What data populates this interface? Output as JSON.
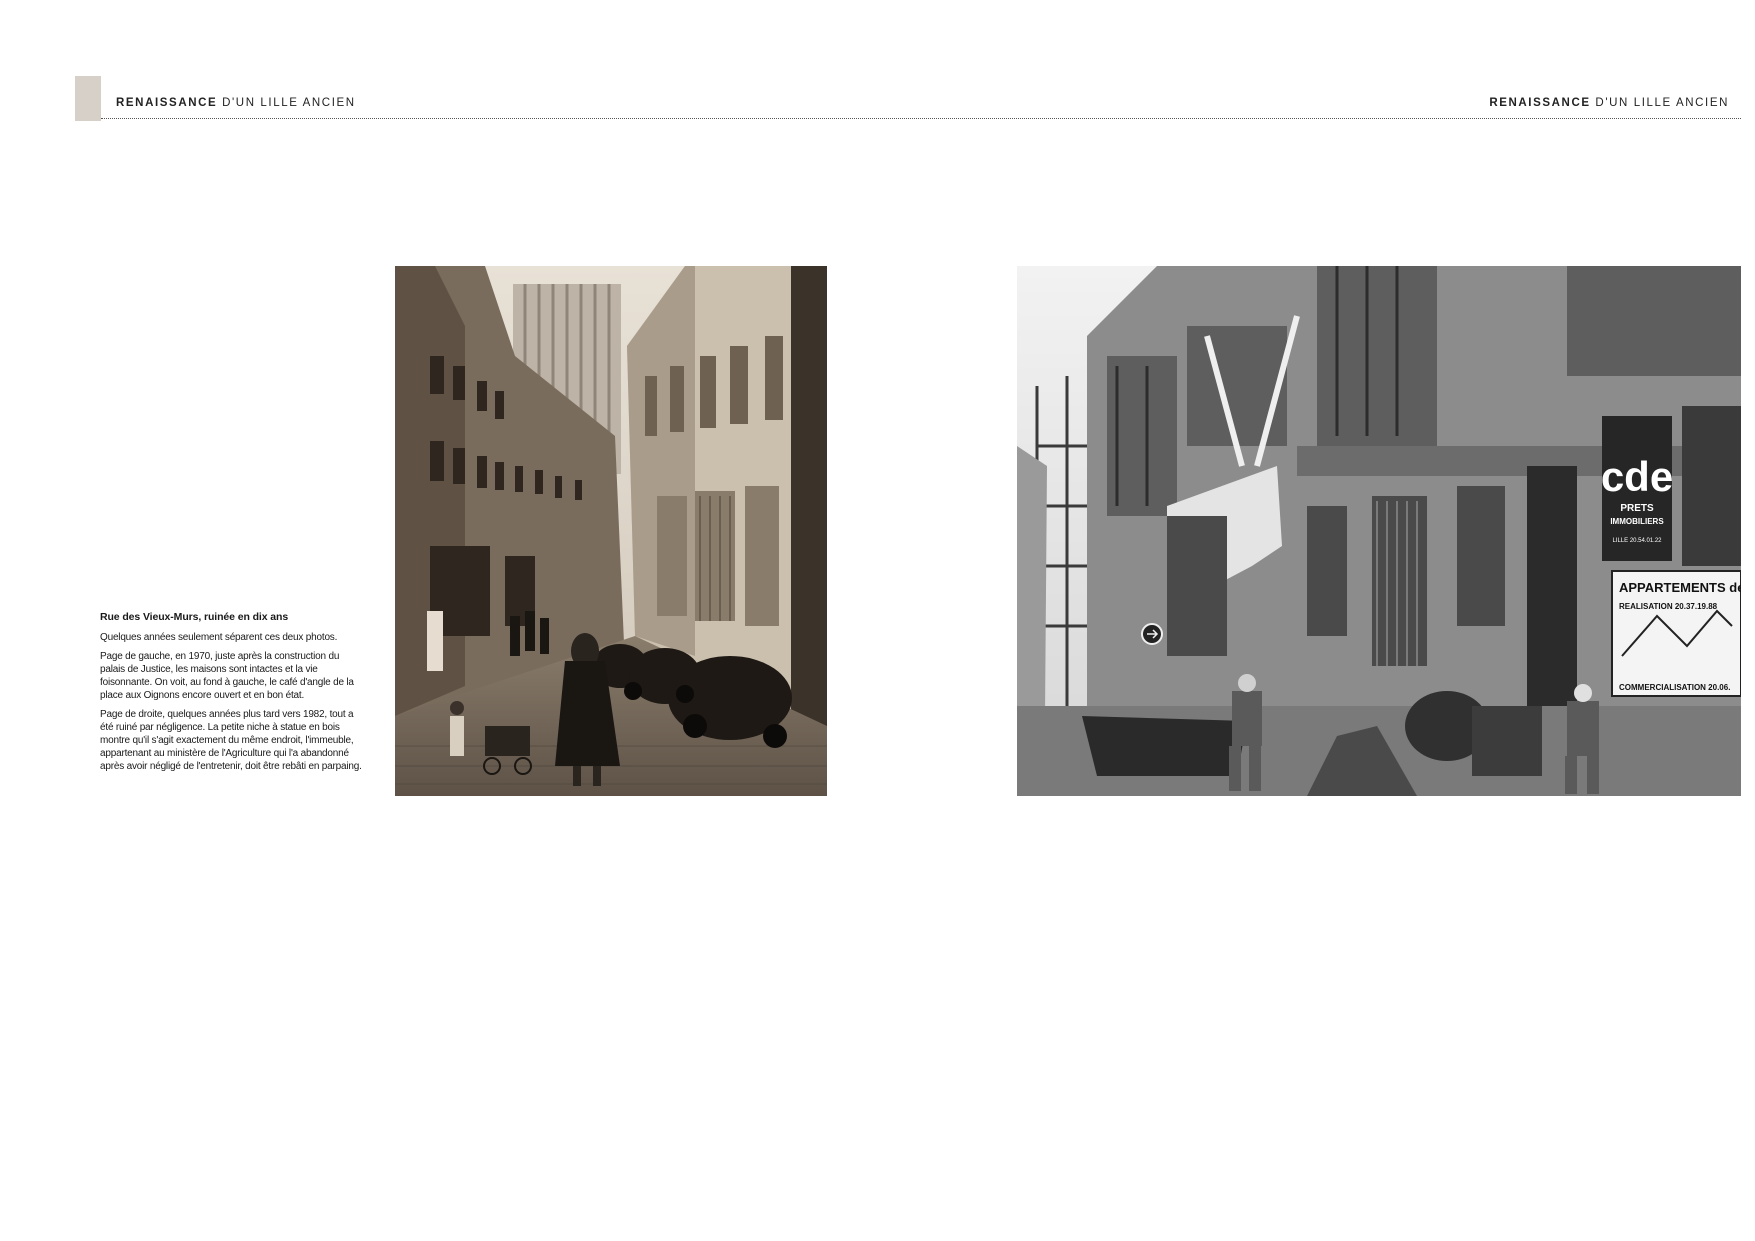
{
  "header": {
    "left": {
      "strong": "RENAISSANCE",
      "rest": " D'UN LILLE ANCIEN"
    },
    "right": {
      "strong": "RENAISSANCE",
      "rest": " D'UN LILLE ANCIEN"
    }
  },
  "caption": {
    "title": "Rue des Vieux-Murs, ruinée en dix ans",
    "paragraphs": [
      "Quelques années seulement séparent ces deux photos.",
      "Page de gauche, en 1970, juste après la construction du palais de Justice, les maisons sont intactes et la vie foisonnante. On voit, au fond à gauche, le café d'angle de la place aux Oignons encore ouvert et en bon état.",
      "Page de droite, quelques années plus tard vers 1982, tout a été ruiné par négligence. La petite niche à statue en bois montre qu'il s'agit exactement du même endroit, l'immeuble, appartenant au ministère de l'Agriculture qui l'a abandonné après avoir négligé de l'entretenir, doit être rebâti en parpaing."
    ]
  },
  "photos": {
    "right_signs": {
      "logo": "cde",
      "logo_sub1": "PRETS",
      "logo_sub2": "IMMOBILIERS",
      "logo_phone": "LILLE 20.54.01.22",
      "banner_title": "APPARTEMENTS de ST",
      "banner_line1": "REALISATION 20.37.19.88",
      "banner_line2": "COMMERCIALISATION 20.06."
    }
  }
}
